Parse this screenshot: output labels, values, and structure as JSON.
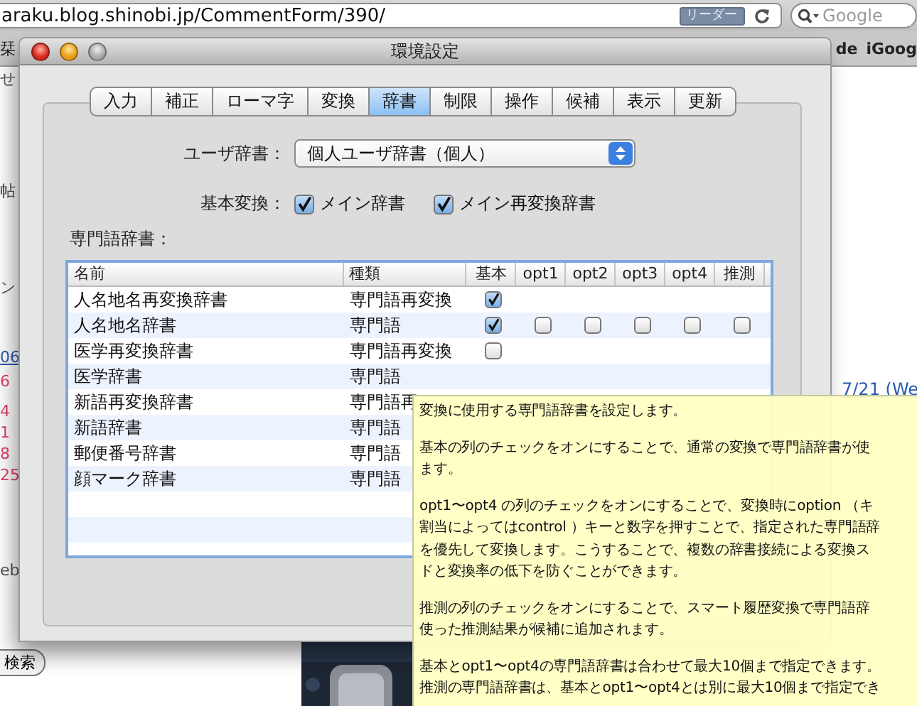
{
  "browser": {
    "url": "araku.blog.shinobi.jp/CommentForm/390/",
    "reader_button": "リーダー",
    "search": {
      "placeholder": "Google"
    },
    "bookmarks_left": [
      "栞"
    ],
    "bookmarks_right": [
      "de",
      "iGoog"
    ],
    "page_fragments": [
      {
        "text": "せ",
        "kind": "plain"
      },
      {
        "text": "帖",
        "kind": "plain"
      },
      {
        "text": "ン",
        "kind": "plain"
      },
      {
        "text": "06",
        "kind": "link"
      },
      {
        "text": "6",
        "kind": "number"
      },
      {
        "text": "4",
        "kind": "number"
      },
      {
        "text": "1",
        "kind": "number"
      },
      {
        "text": "8",
        "kind": "number"
      },
      {
        "text": "25",
        "kind": "number"
      },
      {
        "text": "eb",
        "kind": "plain"
      }
    ],
    "date_link": "7/21 (We",
    "search_button": "検索"
  },
  "window": {
    "title": "環境設定"
  },
  "tabs": [
    {
      "label": "入力",
      "selected": false
    },
    {
      "label": "補正",
      "selected": false
    },
    {
      "label": "ローマ字",
      "selected": false
    },
    {
      "label": "変換",
      "selected": false
    },
    {
      "label": "辞書",
      "selected": true
    },
    {
      "label": "制限",
      "selected": false
    },
    {
      "label": "操作",
      "selected": false
    },
    {
      "label": "候補",
      "selected": false
    },
    {
      "label": "表示",
      "selected": false
    },
    {
      "label": "更新",
      "selected": false
    }
  ],
  "user_dictionary": {
    "label": "ユーザ辞書：",
    "value": "個人ユーザ辞書（個人）"
  },
  "basic_conversion": {
    "label": "基本変換：",
    "options": [
      {
        "label": "メイン辞書",
        "checked": true
      },
      {
        "label": "メイン再変換辞書",
        "checked": true
      }
    ]
  },
  "table": {
    "label": "専門語辞書：",
    "columns": [
      "名前",
      "種類",
      "基本",
      "opt1",
      "opt2",
      "opt3",
      "opt4",
      "推測"
    ],
    "rows": [
      {
        "name": "人名地名再変換辞書",
        "type": "専門語再変換",
        "checks": [
          {
            "checked": true
          }
        ]
      },
      {
        "name": "人名地名辞書",
        "type": "専門語",
        "checks": [
          {
            "checked": true
          },
          {
            "checked": false
          },
          {
            "checked": false
          },
          {
            "checked": false
          },
          {
            "checked": false
          },
          {
            "checked": false
          }
        ]
      },
      {
        "name": "医学再変換辞書",
        "type": "専門語再変換",
        "checks": [
          {
            "checked": false
          }
        ]
      },
      {
        "name": "医学辞書",
        "type": "専門語"
      },
      {
        "name": "新語再変換辞書",
        "type": "専門語再"
      },
      {
        "name": "新語辞書",
        "type": "専門語"
      },
      {
        "name": "郵便番号辞書",
        "type": "専門語"
      },
      {
        "name": "顔マーク辞書",
        "type": "専門語"
      }
    ]
  },
  "tooltip": {
    "paragraphs": [
      [
        "変換に使用する専門語辞書を設定します。"
      ],
      [
        "基本の列のチェックをオンにすることで、通常の変換で専門語辞書が使",
        "ます。"
      ],
      [
        "opt1〜opt4 の列のチェックをオンにすることで、変換時にoption （キ",
        "割当によってはcontrol ）キーと数字を押すことで、指定された専門語辞",
        "を優先して変換します。こうすることで、複数の辞書接続による変換ス",
        "ドと変換率の低下を防ぐことができます。"
      ],
      [
        "推測の列のチェックをオンにすることで、スマート履歴変換で専門語辞",
        "使った推測結果が候補に追加されます。"
      ],
      [
        "基本とopt1〜opt4の専門語辞書は合わせて最大10個まで指定できます。",
        "推測の専門語辞書は、基本とopt1〜opt4とは別に最大10個まで指定でき"
      ]
    ]
  }
}
